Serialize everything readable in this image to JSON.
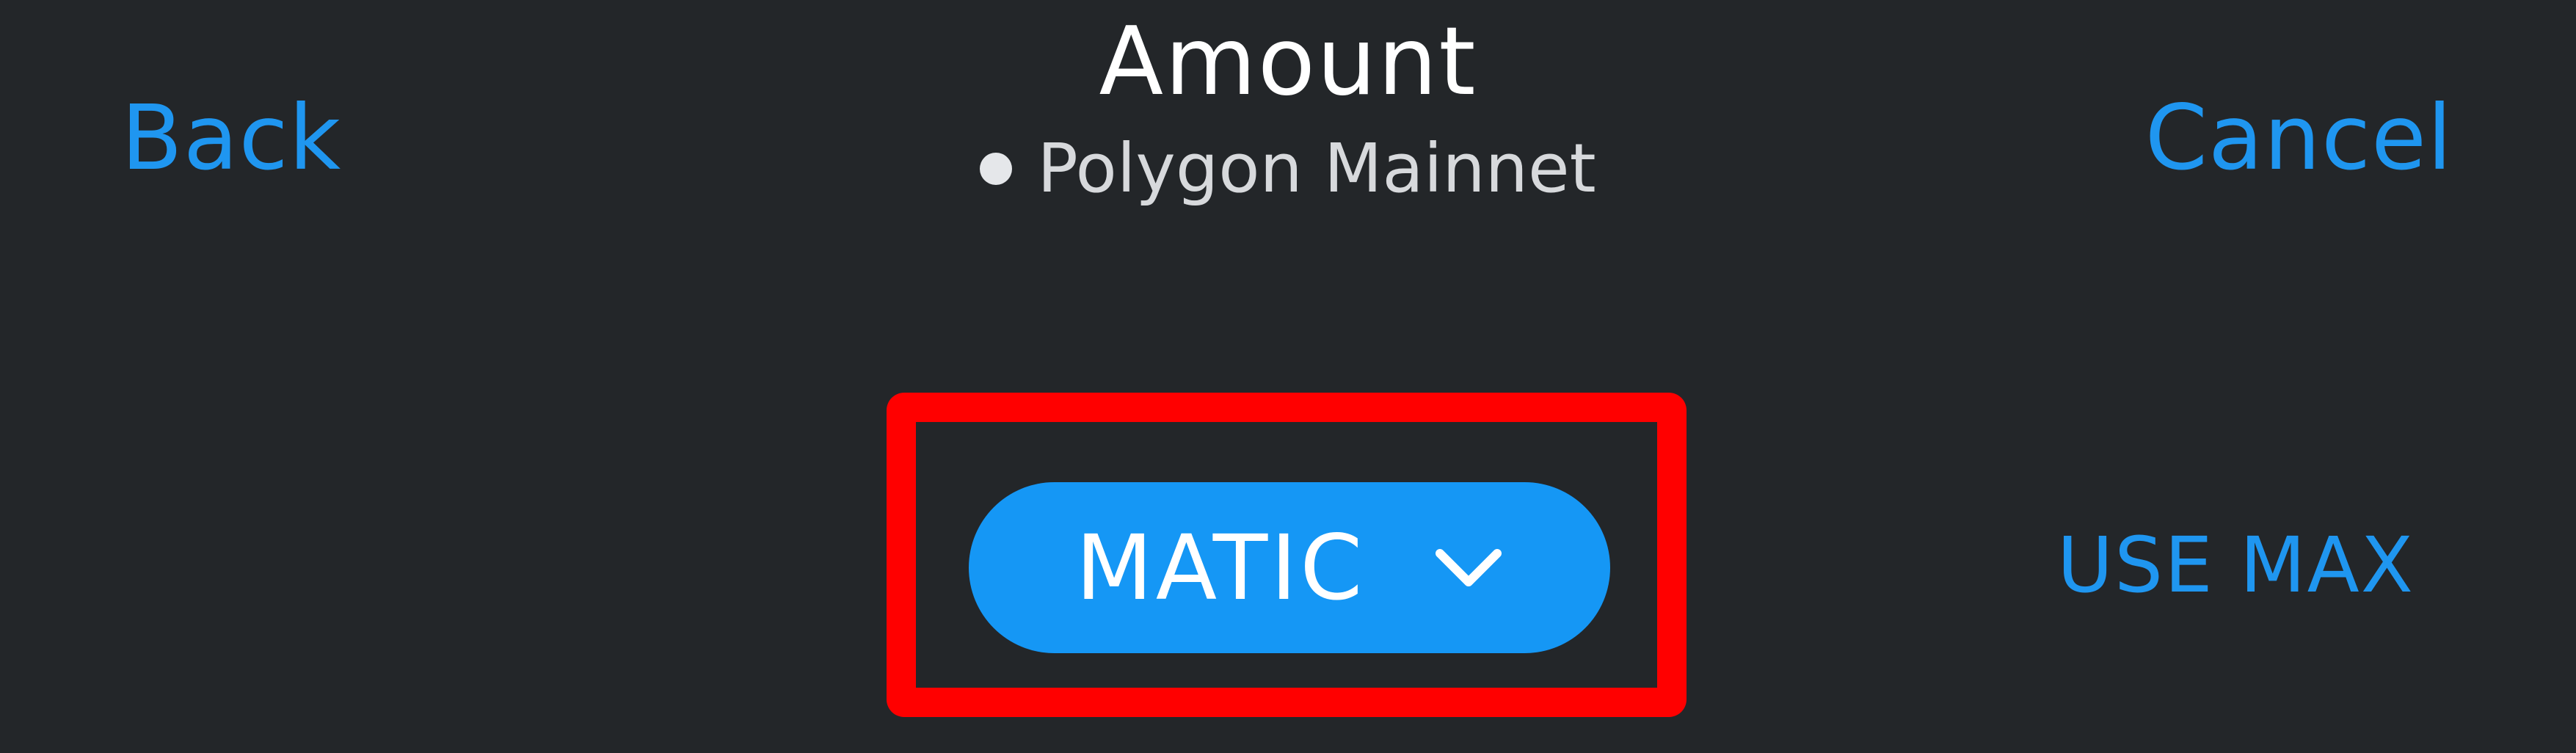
{
  "header": {
    "back_label": "Back",
    "title": "Amount",
    "network": "Polygon Mainnet",
    "cancel_label": "Cancel"
  },
  "token_selector": {
    "label": "MATIC",
    "icon": "chevron-down-icon"
  },
  "use_max_label": "USE MAX",
  "colors": {
    "background": "#232629",
    "accent": "#1f96f0",
    "button": "#1597f5",
    "highlight": "#ff0000",
    "text": "#ffffff"
  }
}
